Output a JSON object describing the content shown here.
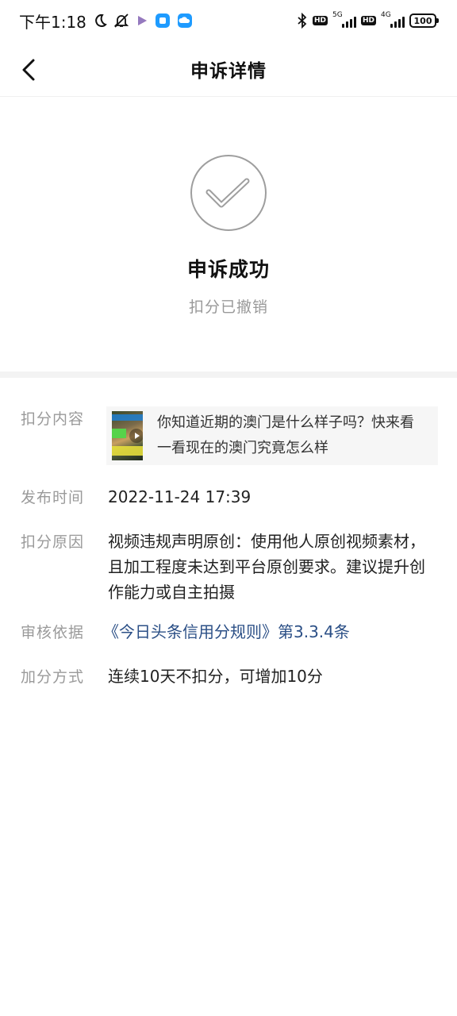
{
  "status_bar": {
    "time": "下午1:18",
    "net1_label": "5G",
    "net2_label": "4G",
    "hd1": "HD",
    "hd2": "HD",
    "battery": "100",
    "icons": [
      "moon-icon",
      "bell-off-icon",
      "play-app-icon",
      "blue-app-icon",
      "cloud-app-icon",
      "bluetooth-icon"
    ]
  },
  "nav": {
    "title": "申诉详情",
    "back_icon": "chevron-left-icon"
  },
  "result": {
    "icon": "check-circle-icon",
    "title": "申诉成功",
    "subtitle": "扣分已撤销"
  },
  "details": {
    "content": {
      "label": "扣分内容",
      "thumbnail_icon": "play-icon",
      "text": "你知道近期的澳门是什么样子吗？快来看一看现在的澳门究竟怎么样"
    },
    "publish_time": {
      "label": "发布时间",
      "value": "2022-11-24 17:39"
    },
    "reason": {
      "label": "扣分原因",
      "value": "视频违规声明原创：使用他人原创视频素材，且加工程度未达到平台原创要求。建议提升创作能力或自主拍摄"
    },
    "basis": {
      "label": "审核依据",
      "value": "《今日头条信用分规则》第3.3.4条"
    },
    "recovery": {
      "label": "加分方式",
      "value": "连续10天不扣分，可增加10分"
    }
  },
  "colors": {
    "link": "#2b4f86",
    "label": "#9a9a9a",
    "divider": "#f3f3f3"
  }
}
